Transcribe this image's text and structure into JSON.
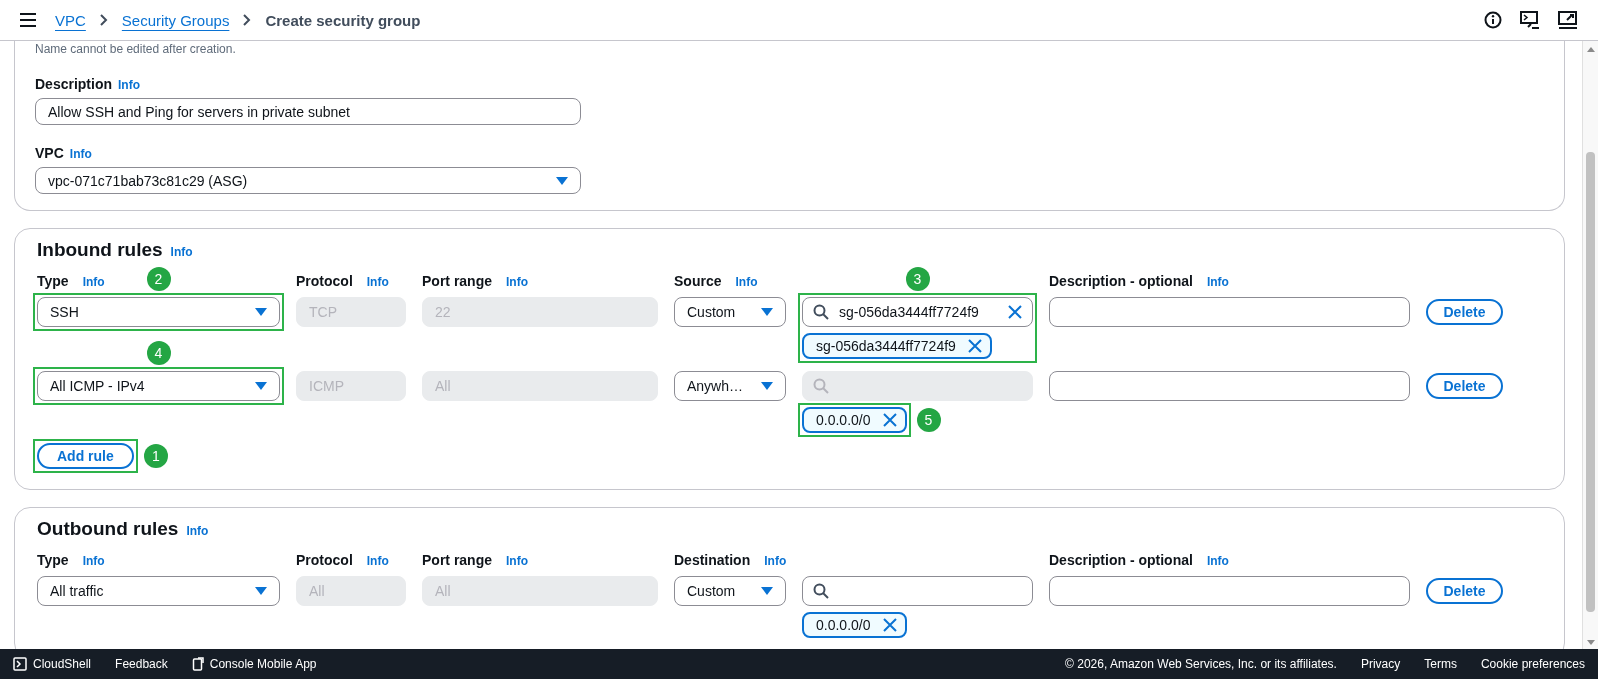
{
  "breadcrumb": [
    {
      "label": "VPC",
      "link": true
    },
    {
      "label": "Security Groups",
      "link": true
    },
    {
      "label": "Create security group",
      "link": false
    }
  ],
  "basic_details": {
    "name_hint": "Name cannot be edited after creation.",
    "description": {
      "label": "Description",
      "info": "Info",
      "value": "Allow SSH and Ping for servers in private subnet"
    },
    "vpc": {
      "label": "VPC",
      "info": "Info",
      "value": "vpc-071c71bab73c81c29 (ASG)"
    }
  },
  "inbound_rules": {
    "title": "Inbound rules",
    "info": "Info",
    "columns": [
      {
        "label": "Type",
        "info": "Info"
      },
      {
        "label": "Protocol",
        "info": "Info"
      },
      {
        "label": "Port range",
        "info": "Info"
      },
      {
        "label": "Source",
        "info": "Info"
      },
      {
        "label": "Description - optional",
        "info": "Info"
      }
    ],
    "rules": [
      {
        "type": "SSH",
        "type_marker": "2",
        "protocol": "TCP",
        "port_range": "22",
        "source": "Custom",
        "search": {
          "value": "sg-056da3444ff7724f9",
          "disabled": false
        },
        "search_marker": "3",
        "chips": [
          "sg-056da3444ff7724f9"
        ],
        "delete": "Delete"
      },
      {
        "type": "All ICMP - IPv4",
        "type_marker": "4",
        "protocol": "ICMP",
        "port_range": "All",
        "source": "Anywh…",
        "search": {
          "disabled": true
        },
        "chips": [
          "0.0.0.0/0"
        ],
        "chips_marker": "5",
        "delete": "Delete"
      }
    ],
    "add_button": {
      "label": "Add rule",
      "marker": "1"
    }
  },
  "outbound_rules": {
    "title": "Outbound rules",
    "info": "Info",
    "columns": [
      {
        "label": "Type",
        "info": "Info"
      },
      {
        "label": "Protocol",
        "info": "Info"
      },
      {
        "label": "Port range",
        "info": "Info"
      },
      {
        "label": "Destination",
        "info": "Info"
      },
      {
        "label": "Description - optional",
        "info": "Info"
      }
    ],
    "rules": [
      {
        "type": "All traffic",
        "protocol": "All",
        "port_range": "All",
        "source": "Custom",
        "search": {
          "disabled": false
        },
        "chips": [
          "0.0.0.0/0"
        ],
        "delete": "Delete"
      }
    ]
  },
  "footer": {
    "tools": [
      "CloudShell",
      "Feedback",
      "Console Mobile App"
    ],
    "copyright": "© 2026, Amazon Web Services, Inc. or its affiliates.",
    "links": [
      "Privacy",
      "Terms",
      "Cookie preferences"
    ]
  }
}
